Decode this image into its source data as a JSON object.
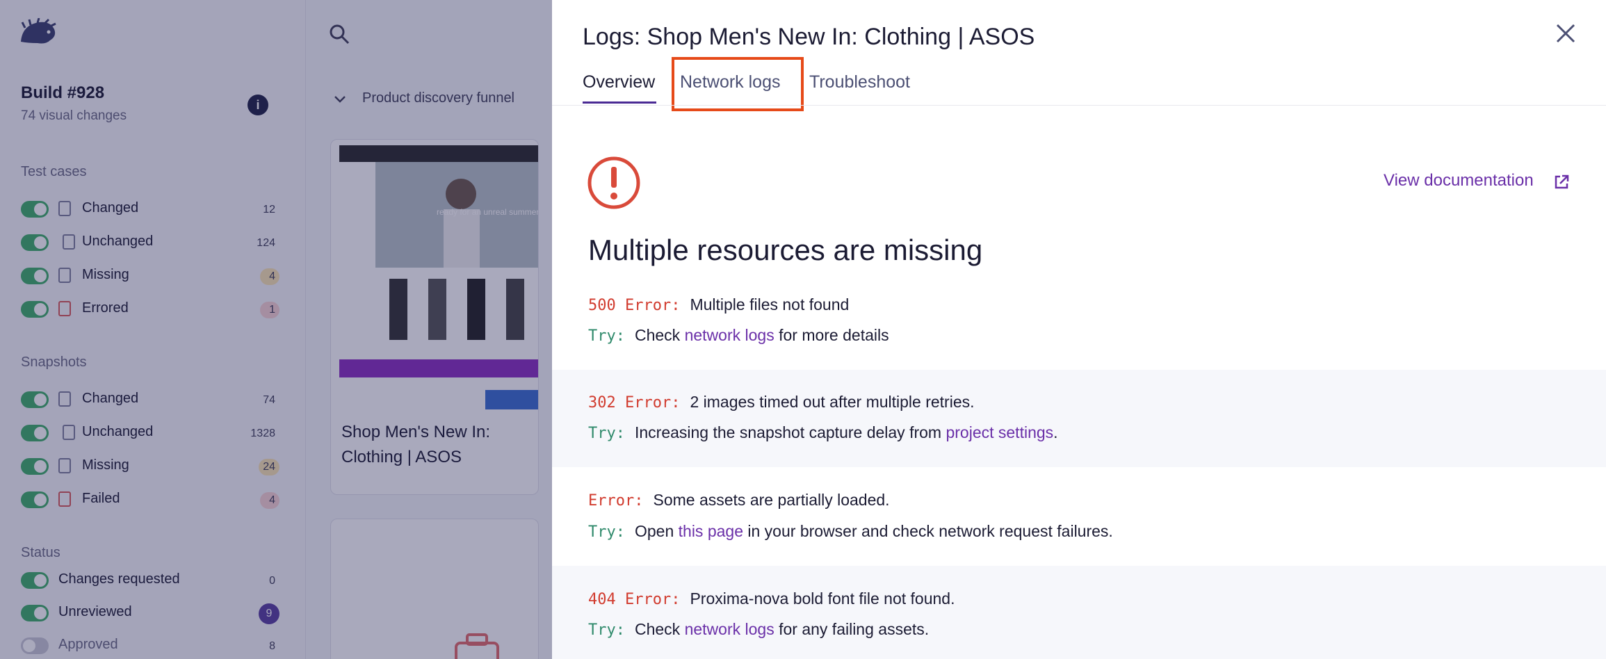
{
  "sidebar": {
    "build_title": "Build #928",
    "build_sub": "74 visual changes",
    "test_cases_title": "Test cases",
    "test_cases": [
      {
        "label": "Changed",
        "count": "12"
      },
      {
        "label": "Unchanged",
        "count": "124"
      },
      {
        "label": "Missing",
        "count": "4"
      },
      {
        "label": "Errored",
        "count": "1"
      }
    ],
    "snapshots_title": "Snapshots",
    "snapshots": [
      {
        "label": "Changed",
        "count": "74"
      },
      {
        "label": "Unchanged",
        "count": "1328"
      },
      {
        "label": "Missing",
        "count": "24"
      },
      {
        "label": "Failed",
        "count": "4"
      }
    ],
    "status_title": "Status",
    "status": [
      {
        "label": "Changes requested",
        "count": "0"
      },
      {
        "label": "Unreviewed",
        "count": "9"
      },
      {
        "label": "Approved",
        "count": "8"
      }
    ]
  },
  "main": {
    "funnel_label": "Product discovery funnel",
    "card_title": "Shop Men's New In: Clothing | ASOS",
    "thumb_text": "ready for an unreal summer"
  },
  "drawer": {
    "title": "Logs: Shop Men's New In: Clothing | ASOS",
    "tabs": [
      "Overview",
      "Network logs",
      "Troubleshoot"
    ],
    "view_doc": "View documentation",
    "heading": "Multiple resources are missing",
    "errors": [
      {
        "code": "500 Error:",
        "message": "Multiple files not found",
        "try_label": "Try:",
        "try_pre": "Check ",
        "try_link": "network logs",
        "try_post": " for more details"
      },
      {
        "code": "302 Error:",
        "message": "2 images timed out after multiple retries.",
        "try_label": "Try:",
        "try_pre": "Increasing the snapshot capture delay from ",
        "try_link": "project settings",
        "try_post": "."
      },
      {
        "code": "Error:",
        "message": "Some assets are partially loaded.",
        "try_label": "Try:",
        "try_pre": "Open ",
        "try_link": "this page",
        "try_post": " in your browser and check network request failures."
      },
      {
        "code": "404 Error:",
        "message": "Proxima-nova bold font file not found.",
        "try_label": "Try:",
        "try_pre": "Check ",
        "try_link": "network logs",
        "try_post": " for any failing assets."
      }
    ]
  },
  "colors": {
    "accent": "#6a2fa8",
    "error": "#d13b2e",
    "try": "#2f8a6b",
    "highlight": "#e64a19"
  }
}
